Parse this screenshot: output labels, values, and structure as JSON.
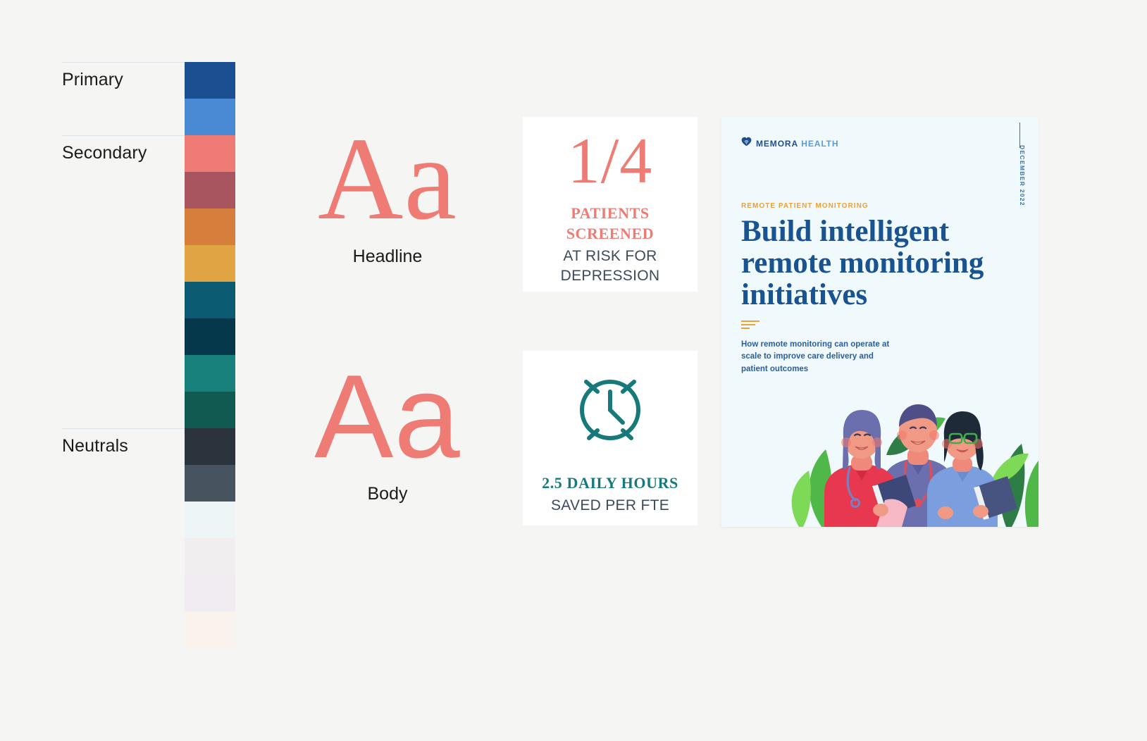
{
  "page": {
    "background": "#f5f5f4"
  },
  "palette": {
    "groups": [
      {
        "label": "Primary",
        "swatch_count": 2
      },
      {
        "label": "Secondary",
        "swatch_count": 8
      },
      {
        "label": "Neutrals",
        "swatch_count": 6
      }
    ],
    "swatches": [
      {
        "name": "primary-deep-blue",
        "hex": "#1a5091"
      },
      {
        "name": "primary-medium-blue",
        "hex": "#4a8ad4"
      },
      {
        "name": "secondary-coral",
        "hex": "#ef7b75"
      },
      {
        "name": "secondary-dusty-rose",
        "hex": "#a8555f"
      },
      {
        "name": "secondary-orange",
        "hex": "#d67f3c"
      },
      {
        "name": "secondary-gold",
        "hex": "#e0a442"
      },
      {
        "name": "secondary-teal-blue",
        "hex": "#0a5a72"
      },
      {
        "name": "secondary-dark-teal",
        "hex": "#05374a"
      },
      {
        "name": "secondary-teal-green",
        "hex": "#18807a"
      },
      {
        "name": "secondary-forest-green",
        "hex": "#105a51"
      },
      {
        "name": "neutral-charcoal",
        "hex": "#2b343c"
      },
      {
        "name": "neutral-slate",
        "hex": "#47535f"
      },
      {
        "name": "neutral-ice-blue",
        "hex": "#edf5f7"
      },
      {
        "name": "neutral-warm-gray",
        "hex": "#f0eeee"
      },
      {
        "name": "neutral-lavender",
        "hex": "#f0ecf2"
      },
      {
        "name": "neutral-cream",
        "hex": "#faf2ec"
      }
    ]
  },
  "typography": {
    "headline": {
      "sample": "Aa",
      "caption": "Headline",
      "color": "#ef7b75"
    },
    "body": {
      "sample": "Aa",
      "caption": "Body",
      "color": "#ef7b75"
    }
  },
  "stat_cards": [
    {
      "id": "patients-screened",
      "value": "1/4",
      "emphasis_line1": "PATIENTS",
      "emphasis_line2": "SCREENED",
      "sub_line1": "AT RISK FOR",
      "sub_line2": "DEPRESSION",
      "accent": "#ef7b75"
    },
    {
      "id": "hours-saved",
      "icon": "alarm-clock-icon",
      "emphasis_line1": "2.5 DAILY HOURS",
      "sub_line1": "SAVED PER FTE",
      "accent": "#17797a"
    }
  ],
  "report_cover": {
    "logo": {
      "icon": "heart-wifi-icon",
      "brand": "MEMORA",
      "suffix": "HEALTH"
    },
    "date": "DECEMBER 2022",
    "eyebrow": "REMOTE PATIENT MONITORING",
    "title": "Build intelligent remote monitoring initiatives",
    "subtitle": "How remote monitoring can operate at scale to improve care delivery and patient outcomes",
    "background": "#f0f9fb",
    "title_color": "#1a5490",
    "eyebrow_color": "#e8a33d",
    "illustration": "three-healthcare-workers-illustration"
  }
}
